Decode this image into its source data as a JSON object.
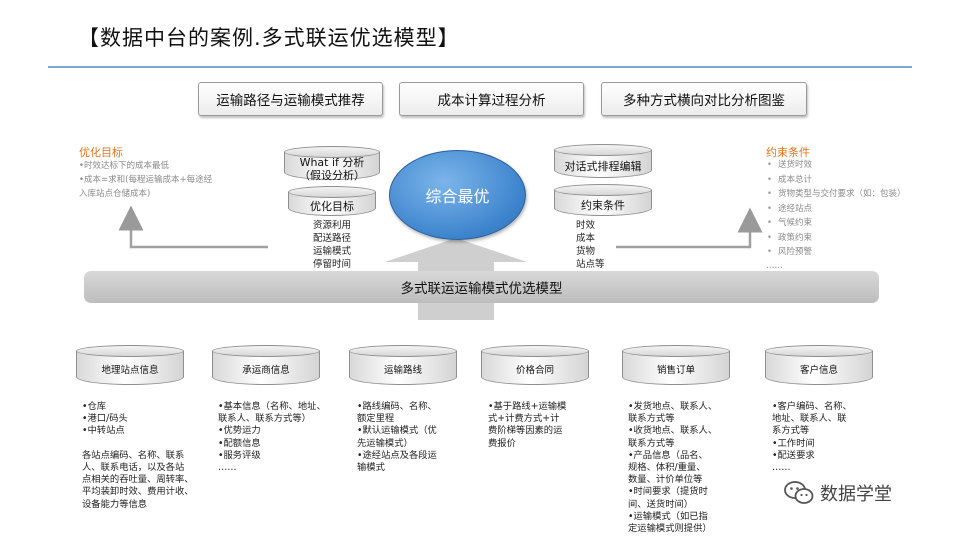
{
  "title": "【数据中台的案例.多式联运优选模型】",
  "top_boxes": [
    "运输路径与运输模式推荐",
    "成本计算过程分析",
    "多种方式横向对比分析图鉴"
  ],
  "left_panel": {
    "title": "优化目标",
    "lines": [
      "•时效达标下的成本最低",
      "•成本=求和(每程运输成本+每途经",
      "入库站点仓储成本)"
    ]
  },
  "right_panel": {
    "title": "约束条件",
    "items": [
      "送货时效",
      "成本总计",
      "货物类型与交付要求（如：包装）",
      "途经站点",
      "气候约束",
      "政策约束",
      "风险预警"
    ],
    "ellipsis": "……"
  },
  "center": {
    "whatif_label_1": "What if 分析",
    "whatif_label_2": "（假设分析）",
    "opt_label": "优化目标",
    "opt_list": [
      "资源利用",
      "配送路径",
      "运输模式",
      "停留时间"
    ],
    "dialog_label": "对话式排程编辑",
    "constraint_label": "约束条件",
    "constraint_list": [
      "时效",
      "成本",
      "货物",
      "站点等"
    ],
    "oval_label": "综合最优"
  },
  "band_label": "多式联运运输模式优选模型",
  "sources": [
    {
      "label": "地理站点信息",
      "lines": [
        "•仓库",
        "•港口/码头",
        "•中转站点",
        "",
        "各站点编码、名称、联系",
        "人、联系电话，以及各站",
        "点相关的吞吐量、周转率、",
        "平均装卸时效、费用计收、",
        "设备能力等信息"
      ]
    },
    {
      "label": "承运商信息",
      "lines": [
        "•基本信息（名称、地址、",
        "联系人、联系方式等）",
        "•优势运力",
        "•配额信息",
        "•服务评级",
        "……"
      ]
    },
    {
      "label": "运输路线",
      "lines": [
        "•路线编码、名称、",
        "额定里程",
        "•默认运输模式（优",
        "先运输模式）",
        "•途经站点及各段运",
        "输模式"
      ]
    },
    {
      "label": "价格合同",
      "lines": [
        "•基于路线+运输模",
        "式+计费方式+计",
        "费阶梯等因素的运",
        "费报价"
      ]
    },
    {
      "label": "销售订单",
      "lines": [
        "•发货地点、联系人、",
        "联系方式等",
        "•收货地点、联系人、",
        "联系方式等",
        "•产品信息（品名、",
        "规格、体积/重量、",
        "数量、计价单位等",
        "•时间要求（提货时",
        "间、送货时间）",
        "•运输模式（如已指",
        "定运输模式则提供）"
      ]
    },
    {
      "label": "客户信息",
      "lines": [
        "•客户编码、名称、",
        "地址、联系人、联",
        "系方式等",
        "•工作时间",
        "•配送要求",
        "……"
      ]
    }
  ],
  "watermark": "数据学堂"
}
